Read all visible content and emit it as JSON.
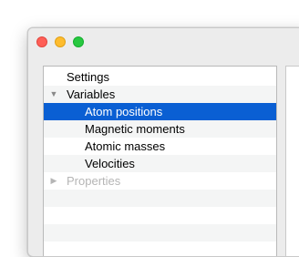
{
  "tree": {
    "items": [
      {
        "label": "Settings",
        "disclosure": ""
      },
      {
        "label": "Variables",
        "disclosure": "▼"
      },
      {
        "label": "Atom positions",
        "disclosure": "",
        "selected": true
      },
      {
        "label": "Magnetic moments",
        "disclosure": ""
      },
      {
        "label": "Atomic masses",
        "disclosure": ""
      },
      {
        "label": "Velocities",
        "disclosure": ""
      },
      {
        "label": "Properties",
        "disclosure": "▶",
        "disabled": true
      }
    ]
  },
  "colors": {
    "selection": "#0a5fd3",
    "close": "#fe5f57",
    "minimize": "#febc2e",
    "zoom": "#28c840",
    "disabled_text": "#b5b5b5"
  }
}
